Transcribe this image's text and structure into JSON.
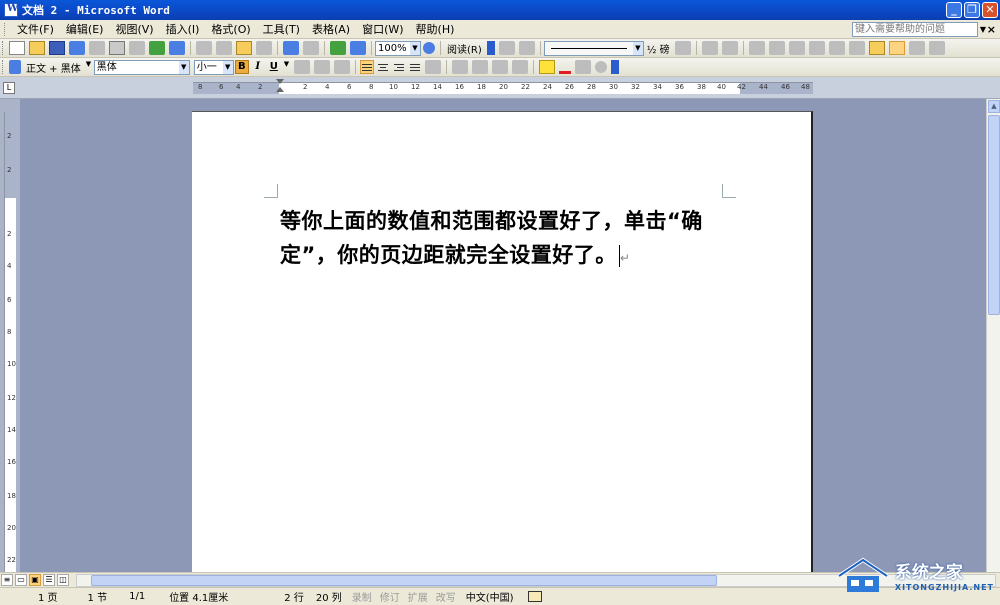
{
  "window": {
    "title": "文档 2 - Microsoft Word",
    "minimize": "_",
    "restore": "❐",
    "close": "✕"
  },
  "menu": {
    "items": [
      "文件(F)",
      "编辑(E)",
      "视图(V)",
      "插入(I)",
      "格式(O)",
      "工具(T)",
      "表格(A)",
      "窗口(W)",
      "帮助(H)"
    ],
    "help_placeholder": "键入需要帮助的问题",
    "close_doc": "×"
  },
  "toolbar": {
    "zoom": "100%",
    "read_button": "阅读(R)",
    "line_weight": "½ 磅"
  },
  "format_bar": {
    "style": "正文 + 黑体",
    "font": "黑体",
    "size": "小一",
    "bold": "B",
    "italic": "I",
    "underline": "U"
  },
  "ruler": {
    "ticks": [
      "8",
      "6",
      "4",
      "2",
      "",
      "2",
      "4",
      "6",
      "8",
      "10",
      "12",
      "14",
      "16",
      "18",
      "20",
      "22",
      "24",
      "26",
      "28",
      "30",
      "32",
      "34",
      "36",
      "38",
      "40",
      "42",
      "44",
      "46",
      "48"
    ],
    "vticks": [
      "2",
      "",
      "2",
      "4",
      "6",
      "8",
      "10",
      "12",
      "14",
      "16",
      "18",
      "20",
      "22"
    ]
  },
  "document": {
    "paragraph": "等你上面的数值和范围都设置好了，单击“确定”，你的页边距就完全设置好了。"
  },
  "status": {
    "page": "1 页",
    "section": "1 节",
    "pages": "1/1",
    "position": "位置 4.1厘米",
    "line": "2 行",
    "column": "20 列",
    "rec": "录制",
    "trk": "修订",
    "ext": "扩展",
    "ovr": "改写",
    "language": "中文(中国)"
  },
  "watermark": {
    "title": "系统之家",
    "subtitle": "XITONGZHIJIA.NET"
  },
  "colors": {
    "titlebar": "#0a57d9",
    "workspace": "#8d97b6",
    "chrome": "#ece9d8"
  }
}
